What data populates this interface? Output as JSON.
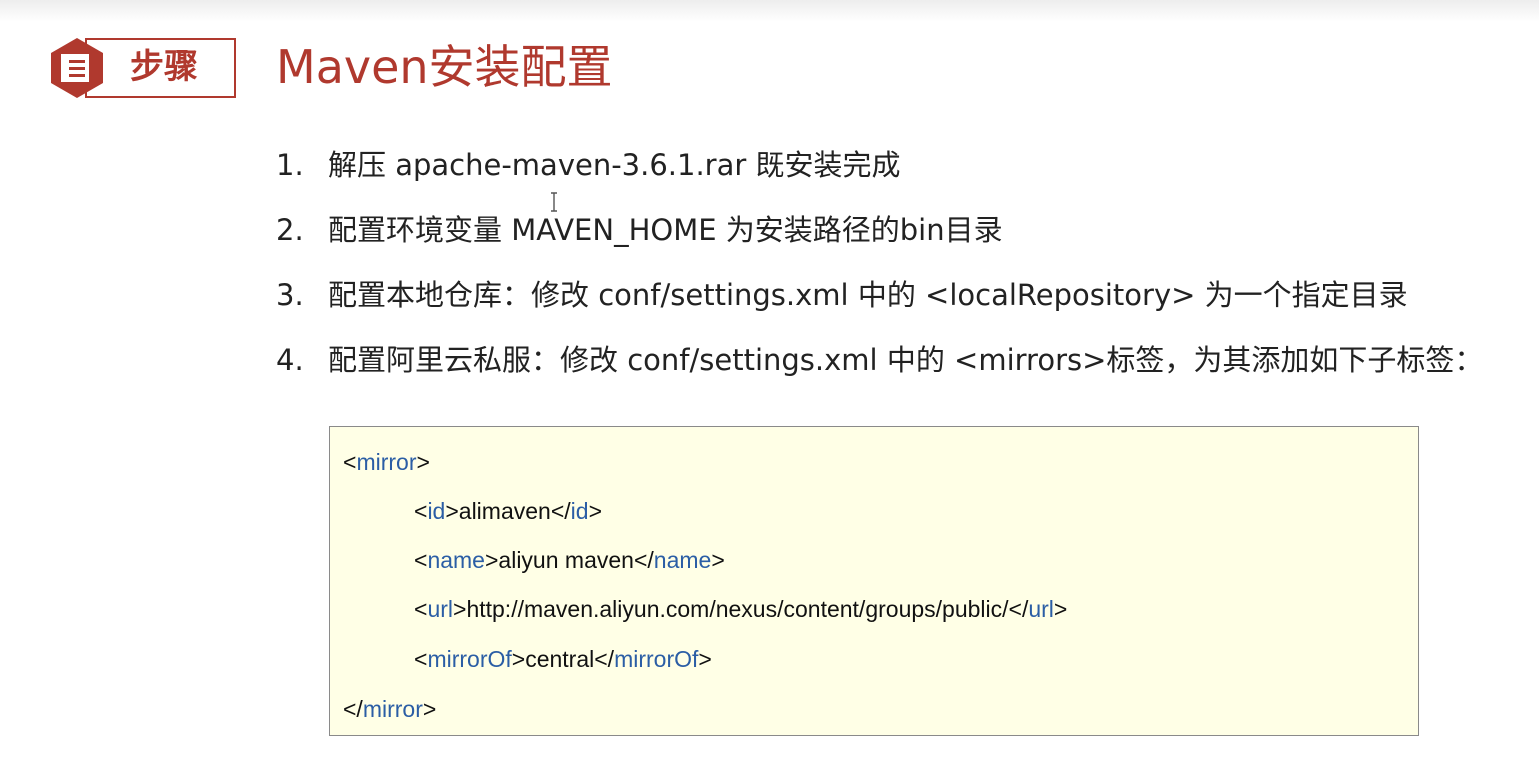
{
  "badge": {
    "icon": "document-icon",
    "label": "步骤"
  },
  "title": "Maven安装配置",
  "steps": [
    {
      "num": "1.",
      "text": "解压 apache-maven-3.6.1.rar 既安装完成"
    },
    {
      "num": "2.",
      "text": "配置环境变量 MAVEN_HOME 为安装路径的bin目录"
    },
    {
      "num": "3.",
      "text": "配置本地仓库：修改 conf/settings.xml 中的 <localRepository> 为一个指定目录"
    },
    {
      "num": "4.",
      "text": "配置阿里云私服：修改 conf/settings.xml 中的 <mirrors>标签，为其添加如下子标签："
    }
  ],
  "code": {
    "mirror_tag": "mirror",
    "id_tag": "id",
    "id_value": "alimaven",
    "name_tag": "name",
    "name_value": "aliyun maven",
    "url_tag": "url",
    "url_value": "http://maven.aliyun.com/nexus/content/groups/public/",
    "mirrorof_tag": "mirrorOf",
    "mirrorof_value": "central"
  },
  "colors": {
    "accent": "#b0392e",
    "code_background": "#ffffe6",
    "tag_name": "#2b5ea5",
    "text": "#222222"
  }
}
